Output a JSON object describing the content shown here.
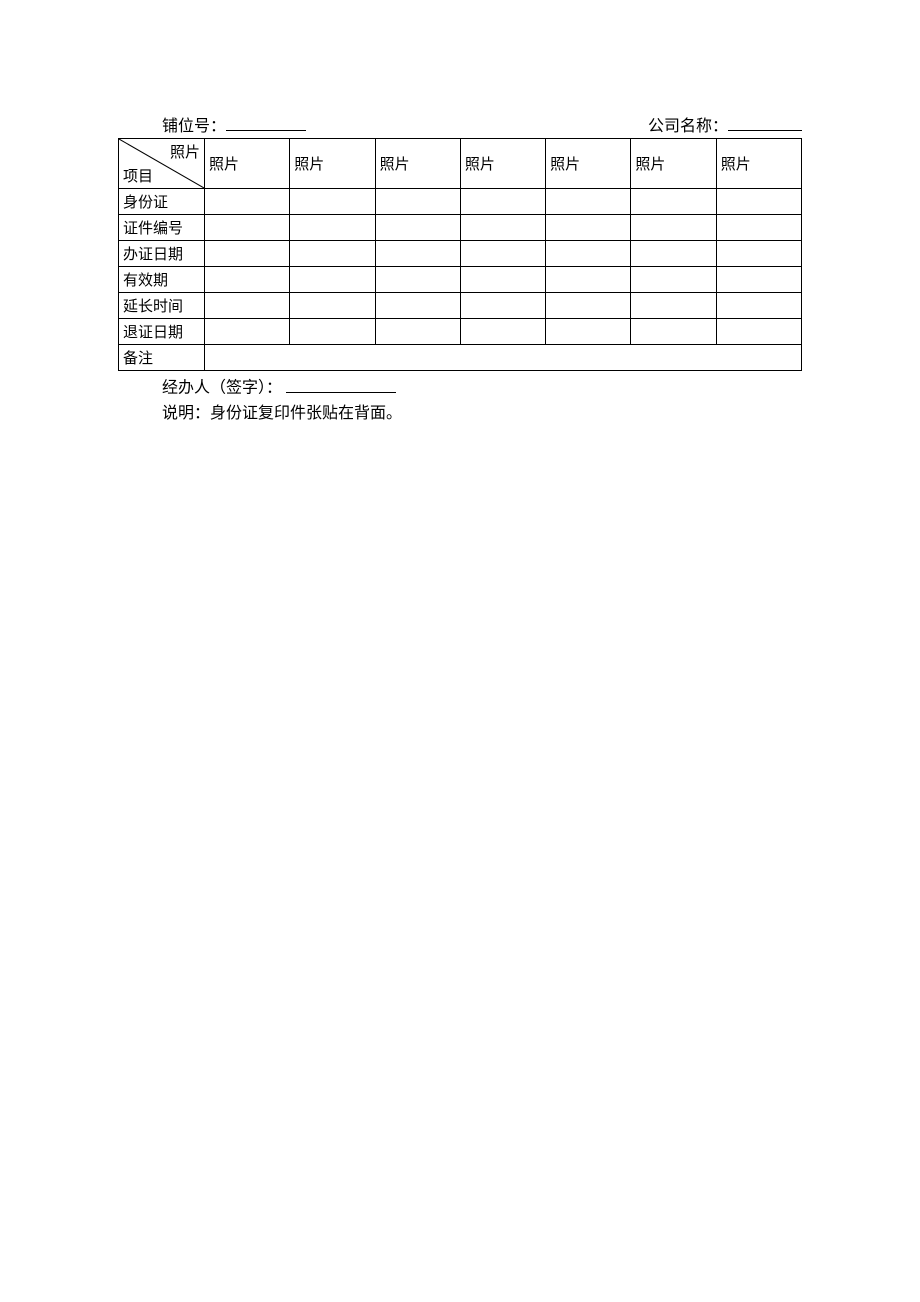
{
  "header": {
    "booth_label": "铺位号：",
    "booth_value": "",
    "company_label": "公司名称：",
    "company_value": ""
  },
  "table": {
    "diag_top": "照片",
    "diag_bottom": "项目",
    "col_headers": [
      "照片",
      "照片",
      "照片",
      "照片",
      "照片",
      "照片",
      "照片"
    ],
    "rows": [
      {
        "label": "身份证",
        "cells": [
          "",
          "",
          "",
          "",
          "",
          "",
          ""
        ]
      },
      {
        "label": "证件编号",
        "cells": [
          "",
          "",
          "",
          "",
          "",
          "",
          ""
        ]
      },
      {
        "label": "办证日期",
        "cells": [
          "",
          "",
          "",
          "",
          "",
          "",
          ""
        ]
      },
      {
        "label": "有效期",
        "cells": [
          "",
          "",
          "",
          "",
          "",
          "",
          ""
        ]
      },
      {
        "label": "延长时间",
        "cells": [
          "",
          "",
          "",
          "",
          "",
          "",
          ""
        ]
      },
      {
        "label": "退证日期",
        "cells": [
          "",
          "",
          "",
          "",
          "",
          "",
          ""
        ]
      }
    ],
    "remark_label": "备注",
    "remark_value": ""
  },
  "footer": {
    "signer_label": "经办人（签字）：",
    "signer_value": "",
    "note": "说明：身份证复印件张贴在背面。"
  }
}
